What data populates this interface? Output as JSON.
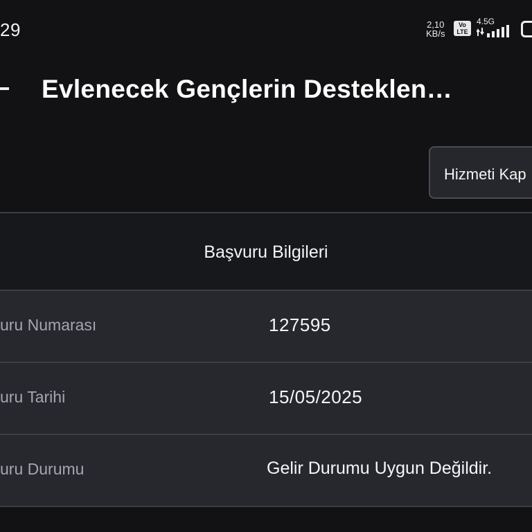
{
  "status_bar": {
    "time": "29",
    "net_speed_value": "2,10",
    "net_speed_unit": "KB/s",
    "volte_top": "Vo",
    "volte_bottom": "LTE",
    "network_type": "4.5G",
    "icons": [
      "signal-icon",
      "battery-icon"
    ]
  },
  "header": {
    "title": "Evlenecek Gençlerin Desteklen…",
    "back_icon": "back-arrow-icon"
  },
  "actions": {
    "close_service_label": "Hizmeti Kap"
  },
  "application_info": {
    "heading": "Başvuru Bilgileri",
    "rows": [
      {
        "label": "uru Numarası",
        "value": "127595"
      },
      {
        "label": "uru Tarihi",
        "value": "15/05/2025"
      },
      {
        "label": "uru Durumu",
        "value": "Gelir Durumu Uygun Değildir."
      }
    ]
  },
  "colors": {
    "background": "#121214",
    "row_background": "#26282e",
    "divider": "#3c3e44",
    "label_text": "#a4a7ad"
  }
}
